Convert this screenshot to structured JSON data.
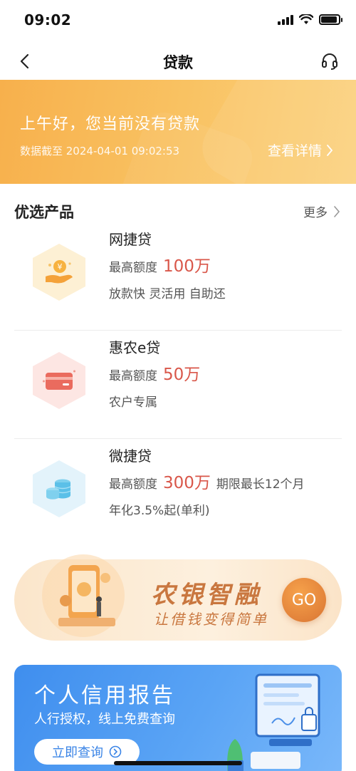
{
  "status_bar": {
    "time": "09:02",
    "battery_level": 0.9
  },
  "nav": {
    "title": "贷款",
    "back_icon": "chevron-left-icon",
    "service_icon": "headset-icon"
  },
  "banner": {
    "greeting": "上午好，您当前没有贷款",
    "date_text": "数据截至 2024-04-01 09:02:53",
    "detail_link": "查看详情"
  },
  "products_section": {
    "title": "优选产品",
    "more": "更多",
    "items": [
      {
        "name": "网捷贷",
        "limit_label": "最高额度",
        "limit_value": "100万",
        "extra": "",
        "desc": "放款快 灵活用 自助还",
        "icon": "hand-coin-icon"
      },
      {
        "name": "惠农e贷",
        "limit_label": "最高额度",
        "limit_value": "50万",
        "extra": "",
        "desc": "农户专属",
        "icon": "bank-card-icon"
      },
      {
        "name": "微捷贷",
        "limit_label": "最高额度",
        "limit_value": "300万",
        "extra": "期限最长12个月",
        "desc": "年化3.5%起(单利)",
        "icon": "coin-stack-icon"
      }
    ]
  },
  "promo": {
    "title": "农银智融",
    "subtitle": "让借钱变得简单",
    "go": "GO"
  },
  "credit": {
    "title": "个人信用报告",
    "subtitle": "人行授权，线上免费查询",
    "button": "立即查询"
  },
  "colors": {
    "banner": "#f9c262",
    "accent_red": "#d9574a",
    "promo": "#c9773f",
    "credit_blue": "#4a96f0"
  }
}
